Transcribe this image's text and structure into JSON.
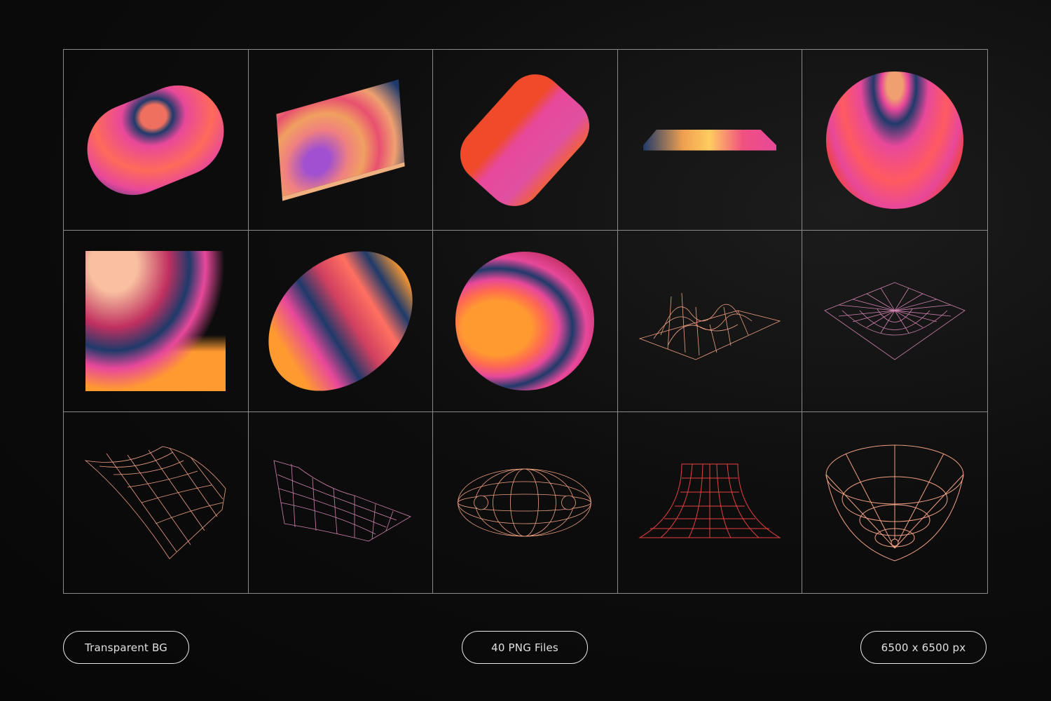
{
  "badges": [
    {
      "label": "Transparent BG"
    },
    {
      "label": "40 PNG Files"
    },
    {
      "label": "6500 x 6500 px"
    }
  ],
  "colors": {
    "background": "#0b0b0b",
    "grid_line": "#8a8a8a",
    "pink": "#e8489a",
    "orange": "#ff8a2a",
    "red": "#f0402a",
    "blue": "#1f3a6a",
    "wire_peach": "#f0a080",
    "wire_pink": "#d080b0",
    "wire_red": "#e84040"
  },
  "items": [
    "capsule-shape",
    "slab-shape",
    "cylinder-shape",
    "flat-plate-shape",
    "sphere-shape",
    "square-gradient-shape",
    "ellipse-gradient-shape",
    "circle-gradient-shape",
    "wire-hills-shape",
    "wire-funnel-plane-shape",
    "wire-wave-sheet-shape",
    "wire-curl-sheet-shape",
    "wire-torus-shape",
    "wire-flare-shape",
    "wire-cone-shape"
  ]
}
